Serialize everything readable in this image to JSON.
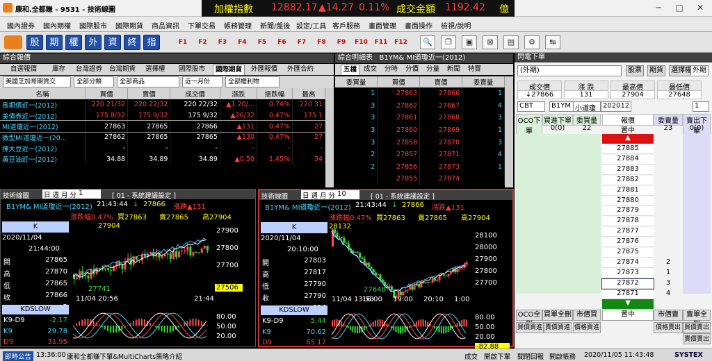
{
  "window": {
    "title": "康和.全都賺 - 9531 - 技術線圖",
    "controls": [
      "─",
      "□",
      "✕"
    ]
  },
  "ticker": {
    "index_label": "加權指數",
    "index_value": "12882.17",
    "change": "▲14.27",
    "pct": "0.11%",
    "amount_label": "成交金額",
    "amount_value": "1192.42",
    "unit": "億"
  },
  "menu": [
    "國內證券",
    "國內期權",
    "國際股市",
    "國際期貨",
    "商品資訊",
    "下單交易",
    "帳務管理",
    "新聞/盤後",
    "設定/工具",
    "客戶服務",
    "畫面管理",
    "畫面操作",
    "檢視/說明"
  ],
  "toolbar": {
    "glyphs": [
      "股",
      "期",
      "權",
      "外",
      "資",
      "終",
      "指"
    ],
    "fkeys": [
      "F1",
      "F2",
      "F3",
      "F4",
      "F5",
      "F6",
      "F7",
      "F8",
      "F9",
      "F10",
      "F11",
      "F12"
    ],
    "icons": [
      "🔍",
      "❐",
      "▣",
      "⊠",
      "▤",
      "⚙",
      "↹"
    ]
  },
  "quote": {
    "title": "綜合報價",
    "tabs": [
      "自選報價",
      "庫存",
      "台灣證券",
      "台灣期貨",
      "選擇權",
      "國際股市",
      "國際期貨",
      "外匯報價",
      "外匯合約"
    ],
    "active_tab": 6,
    "filters": [
      "美國芝加哥期貨交",
      "全部分類",
      "全部商品",
      "近一月份",
      "全部權利物"
    ],
    "headers": [
      "名稱",
      "買價",
      "賣價",
      "成交價",
      "漲跌",
      "振跌幅",
      "最高"
    ],
    "rows": [
      [
        "長期債近一(2012)",
        "220 21/32",
        "220 22/32",
        "220 22/32",
        "▲1 20/...",
        "0.74%",
        "220 31"
      ],
      [
        "美債券近一(2012)",
        "175 8/32",
        "175 9/32",
        "175 9/32",
        "▲26/32",
        "0.47%",
        "175 1"
      ],
      [
        "MI道瓊近一(2012)",
        "27863",
        "27865",
        "27866",
        "▲131",
        "0.47%",
        "27"
      ],
      [
        "微型MI道瓊近一(20...",
        "27862",
        "27865",
        "27865",
        "▲130",
        "0.47%",
        "27"
      ],
      [
        "揮大豆近一(2012)",
        "-",
        "-",
        "-",
        "-",
        "-",
        "-"
      ],
      [
        "黃豆油近一(2012)",
        "34.88",
        "34.89",
        "34.89",
        "▲0.50",
        "1.45%",
        "34"
      ]
    ]
  },
  "detail": {
    "title": "綜合明細表",
    "symbol": "B1YM& MI道瓊近一(2012)",
    "tabs": [
      "五檔",
      "成交",
      "分時",
      "分價",
      "分量",
      "新聞",
      "特寶"
    ],
    "headers": [
      "委買量",
      "買價",
      "賣價",
      "委賣量"
    ],
    "rows": [
      [
        "1",
        "27863",
        "27866",
        "1"
      ],
      [
        "3",
        "27862",
        "27867",
        "4"
      ],
      [
        "3",
        "27861",
        "27868",
        "3"
      ],
      [
        "3",
        "27860",
        "27869",
        "1"
      ],
      [
        "3",
        "27858",
        "27870",
        "3"
      ],
      [
        "2",
        "27857",
        "27871",
        "4"
      ],
      [
        "2",
        "27856",
        "27873",
        "1"
      ],
      [
        "",
        "27855",
        "27874",
        ""
      ]
    ]
  },
  "charts": [
    {
      "title": "技術線圖",
      "period": "日 週 月 分",
      "interval": "1",
      "preset": "[ 01 - 系統建議設定 ]",
      "symbol": "B1YM& MI道瓊近一(2012)",
      "time": "21:43:44",
      "arrow": "↓",
      "price": "27866",
      "chg": "漲跌▲131",
      "pct": "漲跌幅0.47%",
      "bid": "買27863",
      "ask": "賣27865",
      "high": "高27904",
      "date": "2020/11/04",
      "clock": "21:44:00",
      "open_label": "開",
      "open": "27865",
      "high_label": "高",
      "high2": "27870",
      "low_label": "低",
      "low": "27865",
      "close_label": "收",
      "close": "27866",
      "vol_label": "量",
      "vol": "2",
      "ind": "KDSLOW",
      "k9d9": "K9-D9",
      "k9d9v": "-2.17",
      "k9": "K9",
      "k9v": "29.78",
      "d9": "D9",
      "d9v": "31.95",
      "ticks": [
        "27900",
        "27800",
        "27700"
      ],
      "cur": "27506",
      "hilbl": "27904",
      "lolbl": "27741",
      "xt": [
        "11/04 20:56",
        "21:44"
      ],
      "kticks": [
        "80.00",
        "50.00",
        "20.00"
      ],
      "chart_data": {
        "type": "candlestick",
        "y_range": [
          27650,
          27960
        ],
        "high_label": 27904,
        "low_label": 27741,
        "last_close": 27866
      }
    },
    {
      "title": "技術線圖",
      "period": "日 週 月 分",
      "interval": "10",
      "preset": "[ 01 - 系統建議設定 ]",
      "symbol": "B1YM& MI道瓊近一(2012)",
      "time": "21:43:44",
      "arrow": "↓",
      "price": "27866",
      "chg": "漲跌▲131",
      "pct": "漲跌幅0.47%",
      "bid": "買27863",
      "ask": "賣27865",
      "high": "高27904",
      "date": "2020/11/04",
      "clock": "20:10:00",
      "open_label": "開",
      "open": "27803",
      "high_label": "高",
      "high2": "27817",
      "low_label": "低",
      "low": "27790",
      "close_label": "收",
      "close": "27790",
      "vol_label": "量",
      "vol": "214",
      "ind": "KDSLOW",
      "k9d9": "K9-D9",
      "k9d9v": "5.44",
      "k9": "K9",
      "k9v": "70.62",
      "d9": "D9",
      "d9v": "65.17",
      "ticks": [
        "28100",
        "28000",
        "27900",
        "27800",
        "27700"
      ],
      "cur": "",
      "hilbl": "28132",
      "lolbl": "27648",
      "xt": [
        "11/04 13:50",
        "16:00",
        "19:00",
        "20:10",
        "1:00"
      ],
      "kticks": [
        "80.00",
        "50.00",
        "20.00",
        "-82.88"
      ],
      "chart_data": {
        "type": "candlestick",
        "y_range": [
          27600,
          28160
        ],
        "high_label": 28132,
        "low_label": 27648
      }
    }
  ],
  "trade": {
    "title": "閃電下單",
    "acct": "(外期)",
    "tabs": [
      "股票",
      "期貨",
      "選擇權",
      "外期"
    ],
    "hdr": [
      "成交價",
      "漲 跌",
      "最高價",
      "最低價"
    ],
    "vals": [
      "↓27866",
      "131",
      "27904",
      "27648"
    ],
    "exch": "CBT",
    "sym": "B1YM",
    "sym2": "小道瓊",
    "month": "202012",
    "qty": "1",
    "lh": [
      "OCO下單",
      "買進下單",
      "委買量",
      "報價",
      "委賣量",
      "賣出下單"
    ],
    "r1": [
      "0(0)",
      "22",
      "置中",
      "23",
      "0(0)"
    ],
    "prices": [
      "27885",
      "27884",
      "27883",
      "27882",
      "27881",
      "27880",
      "27879",
      "27878",
      "27877",
      "27876",
      "27875",
      "27874",
      "27873",
      "27872",
      "27871"
    ],
    "asks": {
      "27874": "2",
      "27873": "1",
      "27872": "3",
      "27871": "4"
    },
    "bottom": [
      "OCO全刪",
      "買單全刪",
      "市價買",
      "置中",
      "市價賣",
      "賣單全刪"
    ],
    "bottom2": [
      "買價買進",
      "賣價買進",
      "價格買進",
      "價格賣出",
      "買價賣出",
      "賣價賣出"
    ]
  },
  "status": {
    "label": "即時公告",
    "time": "13:36:00",
    "msg": "康和全都賺下單&MultiCharts策略介紹",
    "items": [
      "成交",
      "開啟下單",
      "關閉回報",
      "開啟帳務"
    ],
    "clock": "2020/11/05 11:43:48",
    "brand": "SYSTEX"
  }
}
